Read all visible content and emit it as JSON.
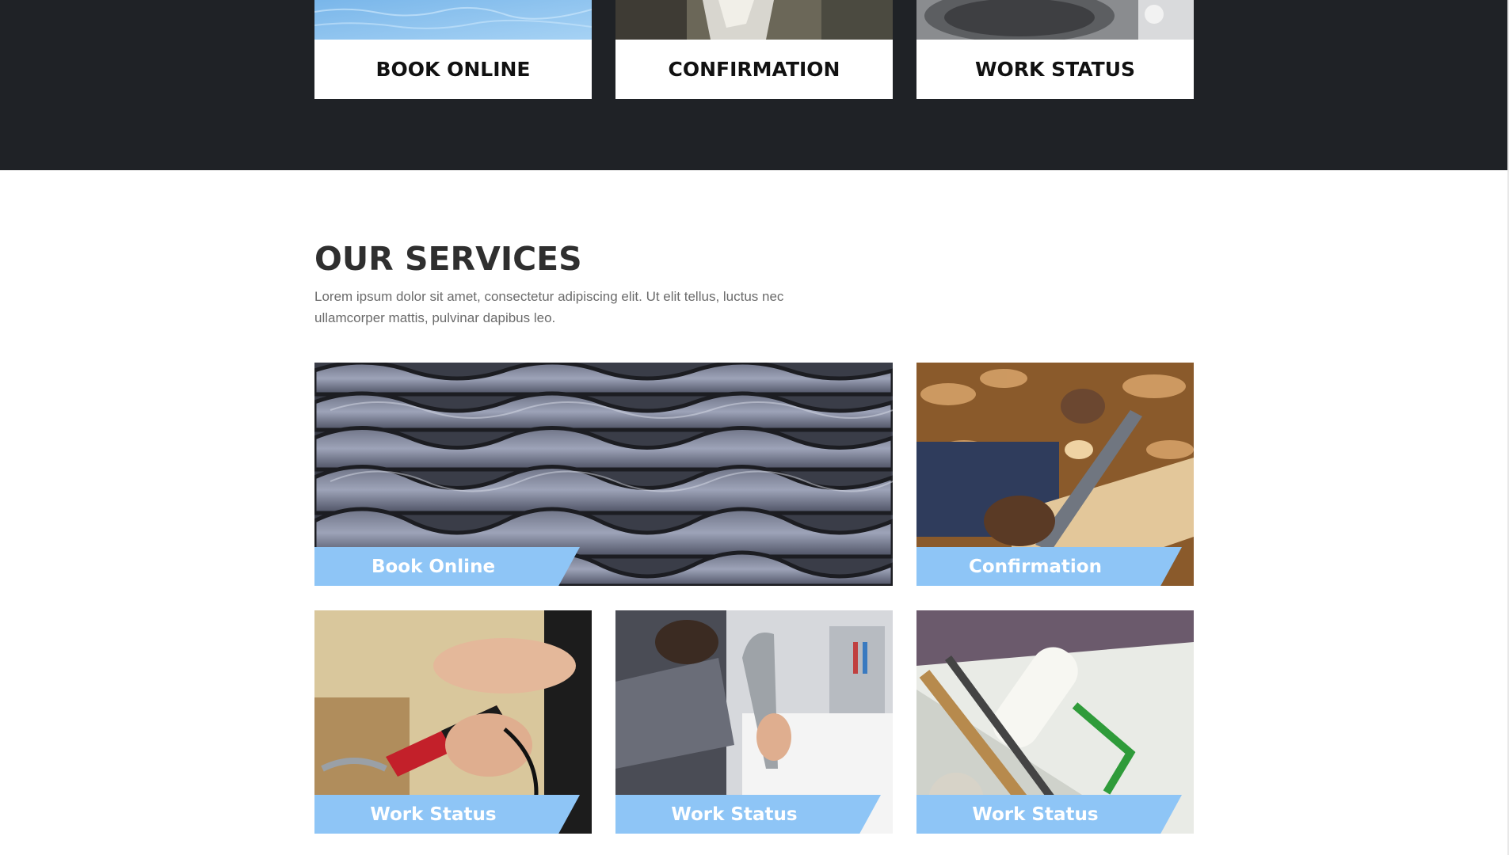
{
  "top_cards": [
    {
      "label": "BOOK ONLINE"
    },
    {
      "label": "CONFIRMATION"
    },
    {
      "label": "WORK STATUS"
    }
  ],
  "services": {
    "title": "OUR SERVICES",
    "description": "Lorem ipsum dolor sit amet, consectetur adipiscing elit. Ut elit tellus, luctus nec ullamcorper mattis, pulvinar dapibus leo."
  },
  "tiles": [
    {
      "label": "Book Online",
      "photo": "metal-roof-tiles"
    },
    {
      "label": "Confirmation",
      "photo": "woodworking-plane"
    },
    {
      "label": "Work Status",
      "photo": "soldering-iron"
    },
    {
      "label": "Work Status",
      "photo": "plumber-faucet"
    },
    {
      "label": "Work Status",
      "photo": "paint-roller"
    }
  ],
  "colors": {
    "dark_band": "#1f2226",
    "badge_blue": "#8ec5f6",
    "title_text": "#2f2f2f"
  }
}
